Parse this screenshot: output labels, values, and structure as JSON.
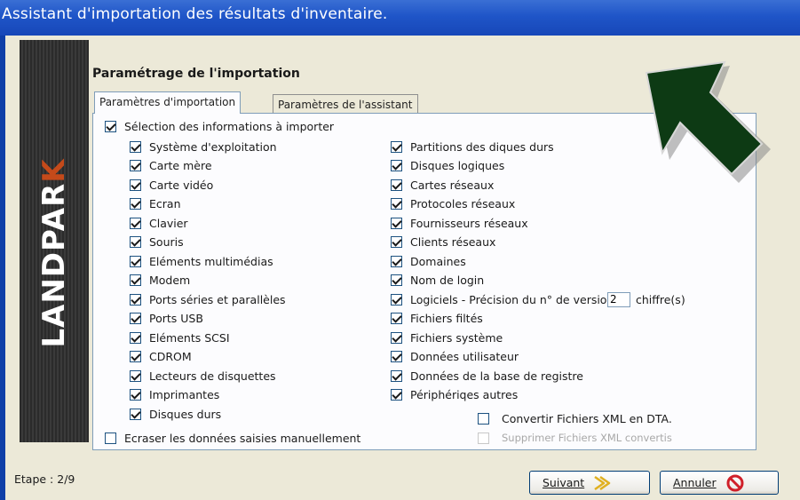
{
  "window": {
    "title": "Assistant d'importation des résultats d'inventaire."
  },
  "sidebar": {
    "brand_main": "LANDPAR",
    "brand_accent": "K"
  },
  "section_title": "Paramétrage de l'importation",
  "tabs": [
    {
      "label": "Paramètres d'importation",
      "active": true
    },
    {
      "label": "Paramètres de l'assistant",
      "active": false
    }
  ],
  "options": {
    "master": {
      "label": "Sélection des informations à importer",
      "checked": true
    },
    "left_column": [
      {
        "label": "Système d'exploitation",
        "checked": true
      },
      {
        "label": "Carte mère",
        "checked": true
      },
      {
        "label": "Carte vidéo",
        "checked": true
      },
      {
        "label": "Ecran",
        "checked": true
      },
      {
        "label": "Clavier",
        "checked": true
      },
      {
        "label": "Souris",
        "checked": true
      },
      {
        "label": "Eléments multimédias",
        "checked": true
      },
      {
        "label": "Modem",
        "checked": true
      },
      {
        "label": "Ports séries et parallèles",
        "checked": true
      },
      {
        "label": "Ports USB",
        "checked": true
      },
      {
        "label": "Eléments SCSI",
        "checked": true
      },
      {
        "label": "CDROM",
        "checked": true
      },
      {
        "label": "Lecteurs de disquettes",
        "checked": true
      },
      {
        "label": "Imprimantes",
        "checked": true
      },
      {
        "label": "Disques durs",
        "checked": true
      }
    ],
    "right_column": [
      {
        "label": "Partitions des diques durs",
        "checked": true
      },
      {
        "label": "Disques logiques",
        "checked": true
      },
      {
        "label": "Cartes réseaux",
        "checked": true
      },
      {
        "label": "Protocoles réseaux",
        "checked": true
      },
      {
        "label": "Fournisseurs réseaux",
        "checked": true
      },
      {
        "label": "Clients réseaux",
        "checked": true
      },
      {
        "label": "Domaines",
        "checked": true
      },
      {
        "label": "Nom de login",
        "checked": true
      },
      {
        "label": "Logiciels  -  Précision du n° de version",
        "checked": true
      },
      {
        "label": "Fichiers filtés",
        "checked": true
      },
      {
        "label": "Fichiers système",
        "checked": true
      },
      {
        "label": "Données utilisateur",
        "checked": true
      },
      {
        "label": "Données de la base de registre",
        "checked": true
      },
      {
        "label": "Périphériqes autres",
        "checked": true
      }
    ],
    "version_precision": {
      "value": "2",
      "suffix": "chiffre(s)"
    },
    "convert_xml": {
      "label": "Convertir Fichiers XML en DTA.",
      "checked": false
    },
    "delete_xml": {
      "label": "Supprimer Fichiers XML convertis",
      "checked": false,
      "disabled": true
    },
    "overwrite_manual": {
      "label": "Ecraser les données saisies manuellement",
      "checked": false
    }
  },
  "footer": {
    "step": "Etape : 2/9",
    "next_label": "Suivant",
    "cancel_label": "Annuler"
  },
  "colors": {
    "titlebar": "#1f55c8",
    "arrow_fill": "#0d3a14",
    "cancel_icon": "#d0202a",
    "next_icon": "#e0b020"
  },
  "icons": {
    "next": "chevron-right-icon",
    "cancel": "no-entry-icon",
    "arrow": "large-arrow-icon"
  }
}
